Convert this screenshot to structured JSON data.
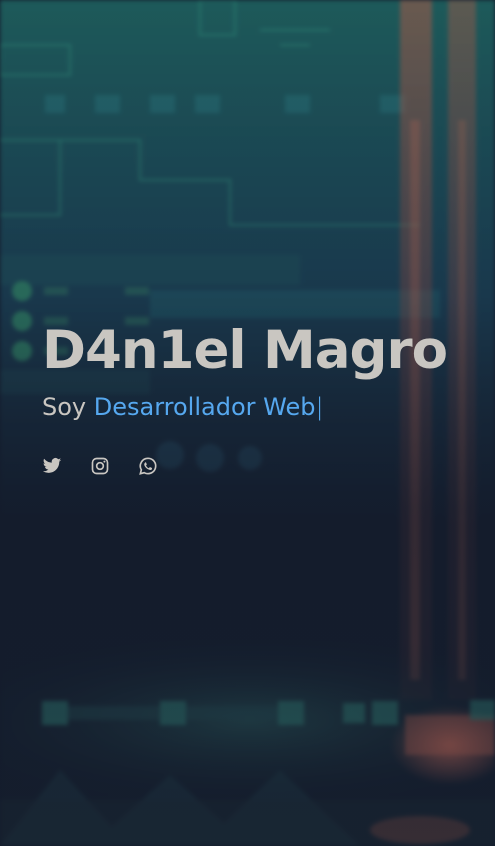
{
  "hero": {
    "name": "D4n1el Magro",
    "subtitle_prefix": "Soy ",
    "subtitle_typed": "Desarrollador Web",
    "cursor": "|"
  },
  "socials": [
    {
      "icon": "twitter-icon"
    },
    {
      "icon": "instagram-icon"
    },
    {
      "icon": "whatsapp-icon"
    }
  ],
  "colors": {
    "background": "#141c2c",
    "text": "#c9c6c1",
    "accent": "#56a8ef",
    "glow_teal": "#2aa58a",
    "glow_orange": "#c8604a"
  }
}
